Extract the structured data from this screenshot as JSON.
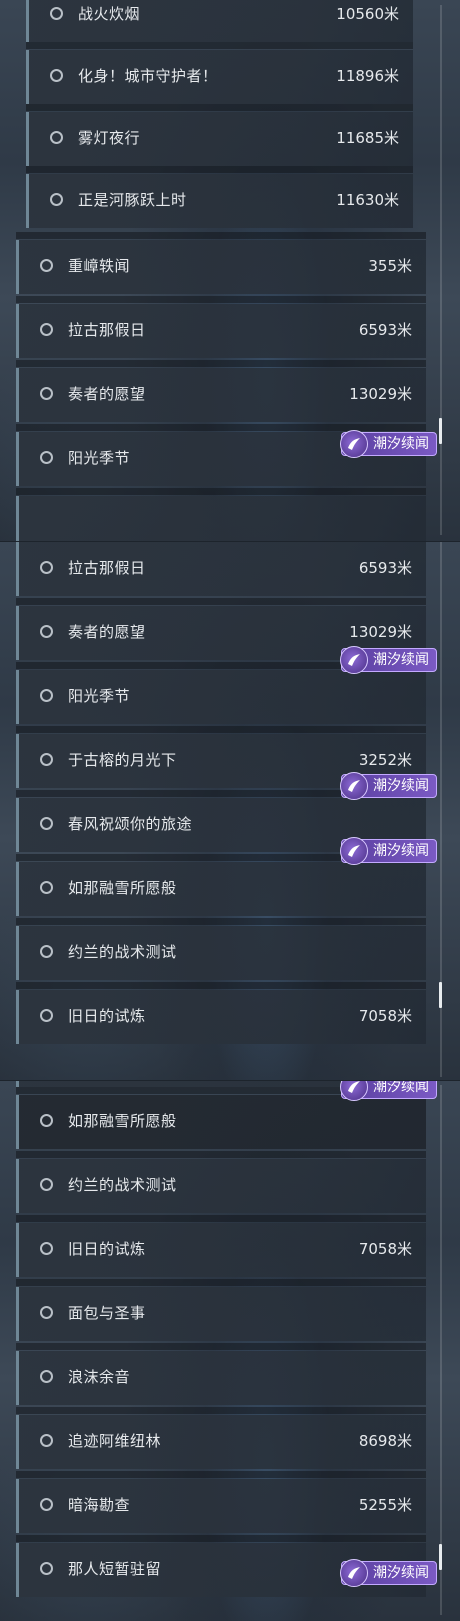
{
  "badge_label": "潮汐续闻",
  "panel1": [
    {
      "name": "战火炊烟",
      "dist": "10560米"
    },
    {
      "name": "化身！城市守护者！",
      "dist": "11896米"
    },
    {
      "name": "雾灯夜行",
      "dist": "11685米"
    },
    {
      "name": "正是河豚跃上时",
      "dist": "11630米"
    },
    {
      "name": "重嶂轶闻",
      "dist": "355米"
    },
    {
      "name": "拉古那假日",
      "dist": "6593米"
    },
    {
      "name": "奏者的愿望",
      "dist": "13029米"
    },
    {
      "name": "阳光季节",
      "dist": ""
    }
  ],
  "panel2": [
    {
      "name": "拉古那假日",
      "dist": "6593米"
    },
    {
      "name": "奏者的愿望",
      "dist": "13029米"
    },
    {
      "name": "阳光季节",
      "dist": ""
    },
    {
      "name": "于古榕的月光下",
      "dist": "3252米"
    },
    {
      "name": "春风祝颂你的旅途",
      "dist": ""
    },
    {
      "name": "如那融雪所愿般",
      "dist": ""
    },
    {
      "name": "约兰的战术测试",
      "dist": ""
    },
    {
      "name": "旧日的试炼",
      "dist": "7058米"
    }
  ],
  "panel3": [
    {
      "name": "如那融雪所愿般",
      "dist": ""
    },
    {
      "name": "约兰的战术测试",
      "dist": ""
    },
    {
      "name": "旧日的试炼",
      "dist": "7058米"
    },
    {
      "name": "面包与圣事",
      "dist": ""
    },
    {
      "name": "浪沫余音",
      "dist": ""
    },
    {
      "name": "追迹阿维纽林",
      "dist": "8698米"
    },
    {
      "name": "暗海勘查",
      "dist": "5255米"
    },
    {
      "name": "那人短暂驻留",
      "dist": ""
    }
  ],
  "icons": {
    "radio": "circle-outline-icon",
    "badge": "tidal-badge-icon"
  },
  "colors": {
    "badge": "#6a4cb4",
    "badge_border": "#c3a9ff",
    "row_accent": "#6f8796",
    "text": "#e6e9ec"
  }
}
